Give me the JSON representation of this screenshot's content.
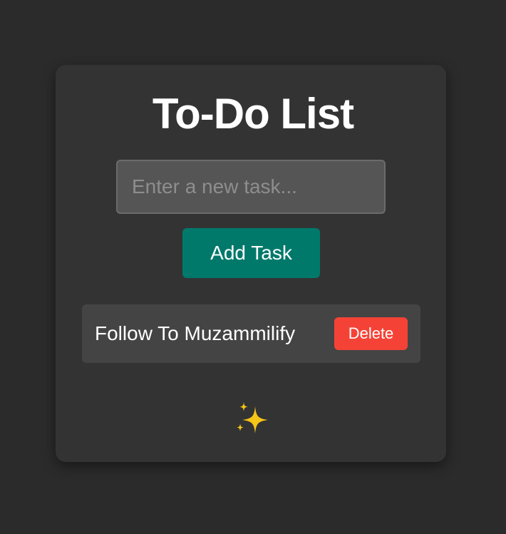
{
  "app": {
    "title": "To-Do List"
  },
  "input": {
    "value": "",
    "placeholder": "Enter a new task..."
  },
  "actions": {
    "add_label": "Add Task"
  },
  "tasks": [
    {
      "text": "Follow To Muzammilify",
      "delete_label": "Delete"
    }
  ],
  "footer": {
    "icon": "sparkles-icon"
  },
  "colors": {
    "background": "#2b2b2b",
    "card": "#333333",
    "accent": "#00796b",
    "danger": "#f44336",
    "sparkle": "#f5c518"
  }
}
